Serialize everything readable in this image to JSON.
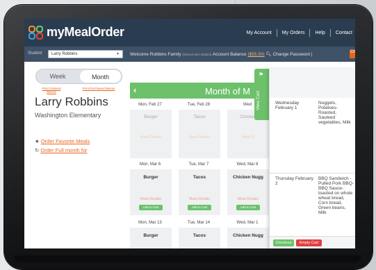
{
  "app": {
    "name": "myMealOrder"
  },
  "header": {
    "nav": [
      "My Account",
      "My Orders",
      "Help",
      "Contact"
    ]
  },
  "subbar": {
    "student_label": "Student",
    "student_selected": "Larry Robbins",
    "welcome_prefix": "Welcome Robbins Family",
    "district": "(School USA District)",
    "balance_label": "Account Balance",
    "balance_value": "($55.50)",
    "change_password": "Change Password",
    "orange_tab": "Ch"
  },
  "left": {
    "toggle": {
      "week": "Week",
      "month": "Month"
    },
    "print_ordered": "Print Ordered Menus",
    "print_purchased": "Print Purchased Menus",
    "student_name": "Larry Robbins",
    "school": "Washington Elementary",
    "order_favorite": "Order Favorite Meals",
    "order_full_month": "Order Full month for"
  },
  "calendar": {
    "title": "Month of M",
    "weeks": [
      {
        "days": [
          {
            "date": "Mon, Feb 27",
            "meal": "Burger",
            "details": "Meal Details",
            "add": ""
          },
          {
            "date": "Tue, Feb 28",
            "meal": "Tacos",
            "details": "Meal Details",
            "add": ""
          },
          {
            "date": "Wed",
            "meal": "Chicken",
            "details": "Meal D",
            "add": ""
          }
        ]
      },
      {
        "days": [
          {
            "date": "Mon, Mar 6",
            "meal": "Burger",
            "details": "Meal Details",
            "add": "Add to Cart"
          },
          {
            "date": "Tue, Mar 7",
            "meal": "Tacos",
            "details": "Meal Details",
            "add": "Add to Cart"
          },
          {
            "date": "Wed, Mar 8",
            "meal": "Chicken Nugg",
            "details": "Meal Details",
            "add": "Add to Cart"
          }
        ]
      },
      {
        "days": [
          {
            "date": "Mon, Mar 13",
            "meal": "Burger"
          },
          {
            "date": "Tue, Mar 14",
            "meal": "Tacos"
          },
          {
            "date": "Wed, Mar 1",
            "meal": "Chicken Nugg"
          }
        ]
      }
    ]
  },
  "cart": {
    "tab_label": "View Cart",
    "rows": [
      {
        "day": "Wednesday February 1",
        "items": "Nuggets, Potatoes- Roasted, Sauteed vegetables, Milk"
      },
      {
        "day": "Thursday February 2",
        "items": "BBQ Sandwich - Pulled Pork BBQ- BBQ Sauce- toasted on whole wheat bread, Corn bread, Green beans, Milk"
      }
    ],
    "checkout": "Checkout",
    "empty": "Empty Cart"
  }
}
